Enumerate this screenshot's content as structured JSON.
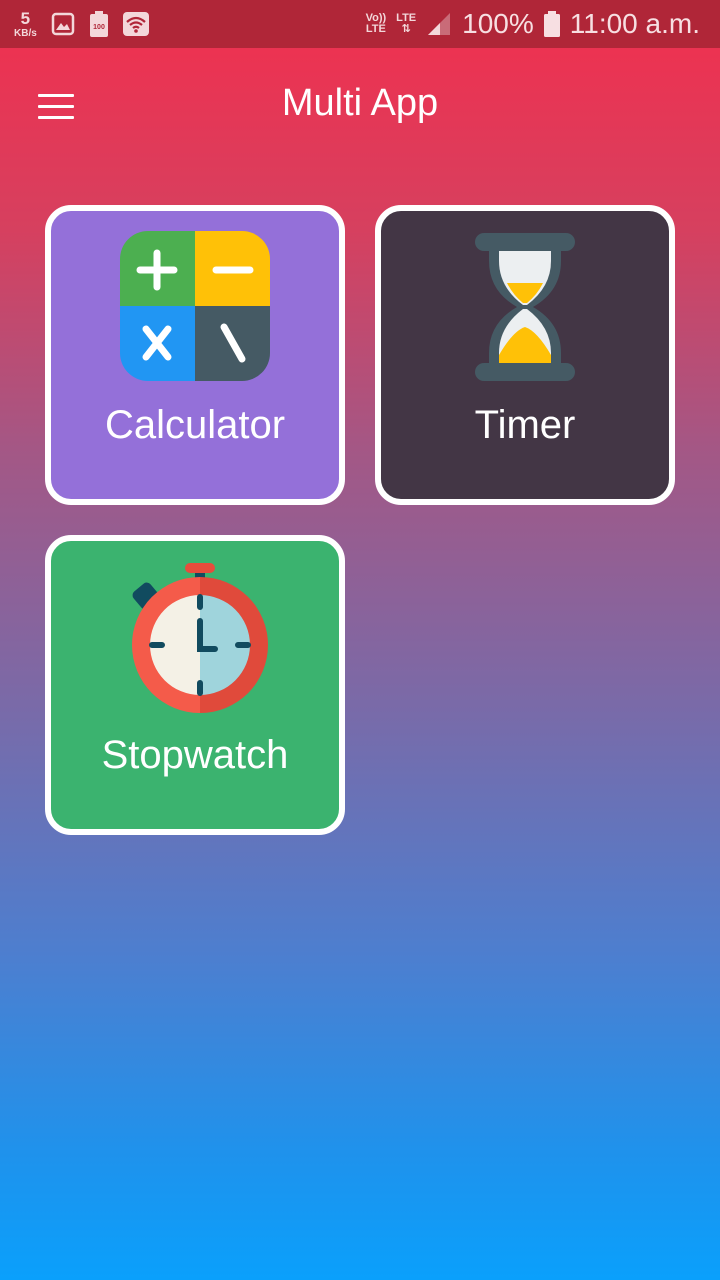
{
  "status_bar": {
    "speed_value": "5",
    "speed_unit": "KB/s",
    "volte": "Vo))",
    "volte_lte": "LTE",
    "lte": "LTE",
    "battery": "100%",
    "battery_icon_text": "100",
    "time": "11:00 a.m.",
    "icons": [
      "gallery-icon",
      "battery-saver-icon",
      "wifi-icon",
      "signal-icon",
      "battery-icon"
    ]
  },
  "app_bar": {
    "title": "Multi App",
    "menu_icon": "hamburger-menu-icon"
  },
  "tiles": [
    {
      "label": "Calculator",
      "icon": "calculator-icon",
      "color": "#9470d9"
    },
    {
      "label": "Timer",
      "icon": "hourglass-icon",
      "color": "#433645"
    },
    {
      "label": "Stopwatch",
      "icon": "stopwatch-icon",
      "color": "#3bb36f"
    }
  ]
}
